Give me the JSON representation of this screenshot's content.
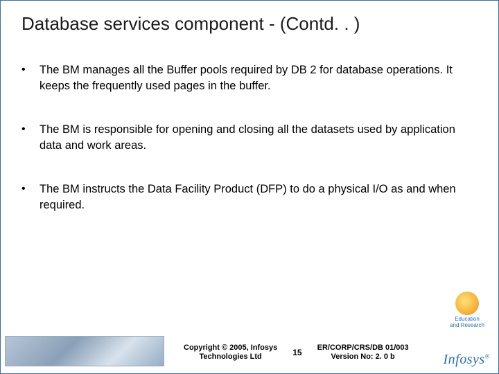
{
  "title": "Database services component - (Contd. . )",
  "bullets": [
    "The BM manages all the Buffer pools required by DB 2 for database operations.  It keeps the frequently used pages in the buffer.",
    "The BM is responsible for opening and closing all the datasets used by application data and work areas.",
    "The BM instructs the Data Facility Product (DFP) to do a physical I/O as and when required."
  ],
  "footer": {
    "copyright_line1": "Copyright © 2005, Infosys",
    "copyright_line2": "Technologies Ltd",
    "page_number": "15",
    "docid_line1": "ER/CORP/CRS/DB 01/003",
    "docid_line2": "Version No: 2. 0 b"
  },
  "edu_logo": {
    "line1": "Education",
    "line2": "and Research"
  },
  "company_logo_text": "Infosys"
}
